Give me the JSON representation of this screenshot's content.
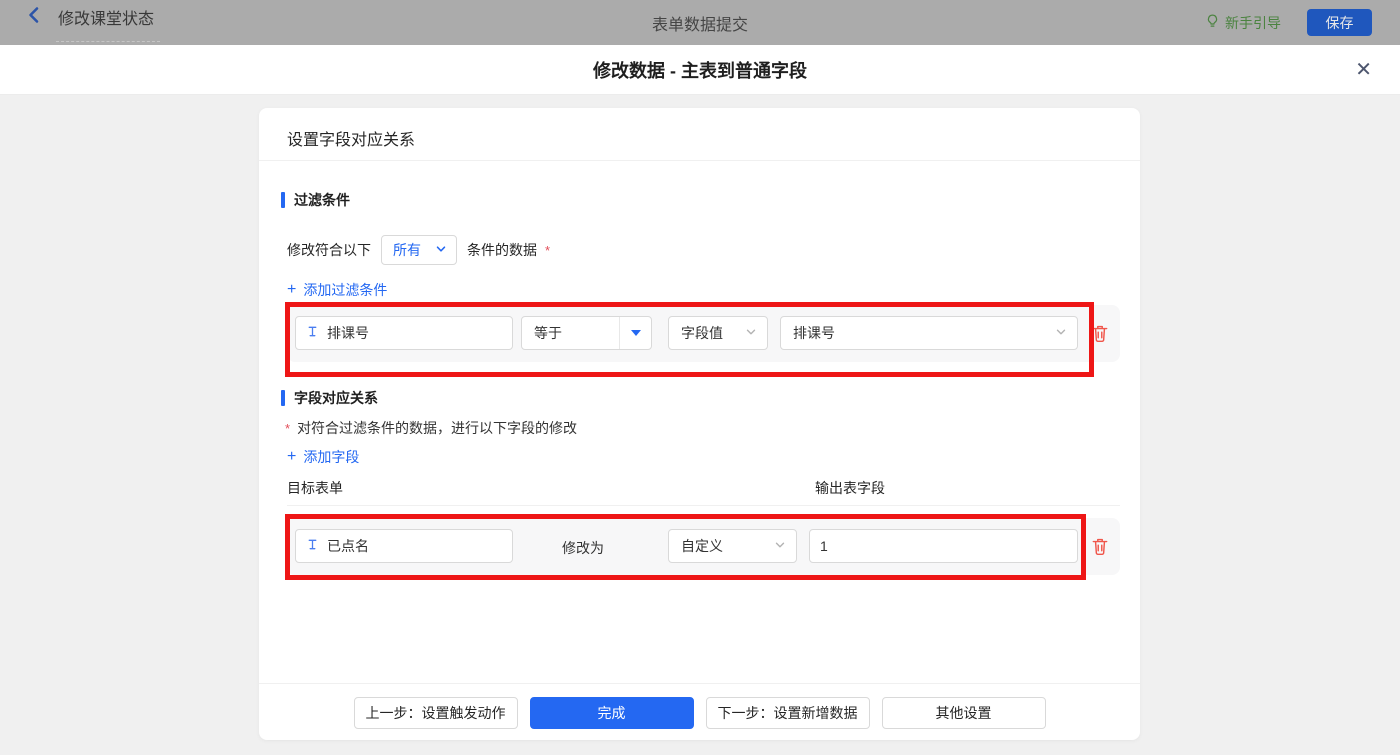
{
  "topbar": {
    "title": "修改课堂状态",
    "center_title": "表单数据提交",
    "guide_label": "新手引导",
    "save_label": "保存"
  },
  "modal": {
    "title": "修改数据 - 主表到普通字段",
    "close_glyph": "✕"
  },
  "card": {
    "header": "设置字段对应关系",
    "filter_section": {
      "title": "过滤条件",
      "sentence_prefix": "修改符合以下",
      "match_mode": "所有",
      "sentence_suffix": "条件的数据",
      "required_mark": "*",
      "add_icon": "+",
      "add_label": "添加过滤条件",
      "row": {
        "field": "排课号",
        "operator": "等于",
        "value_type": "字段值",
        "value": "排课号"
      }
    },
    "mapping_section": {
      "title": "字段对应关系",
      "required_mark": "*",
      "note": "对符合过滤条件的数据，进行以下字段的修改",
      "add_icon": "+",
      "add_label": "添加字段",
      "col_target": "目标表单",
      "col_output": "输出表字段",
      "row": {
        "field": "已点名",
        "action_label": "修改为",
        "mode": "自定义",
        "value": "1"
      }
    },
    "footer": {
      "prev_label": "上一步：设置触发动作",
      "done_label": "完成",
      "next_label": "下一步：设置新增数据",
      "other_label": "其他设置"
    }
  },
  "colors": {
    "accent_blue": "#2468f2",
    "annotation_red": "#ee1616",
    "danger_red": "#f0564b",
    "guide_green": "#4b8340"
  }
}
